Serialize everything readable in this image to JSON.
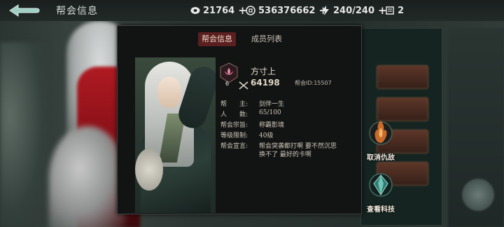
{
  "header": {
    "title": "帮会信息",
    "resources": [
      {
        "icon": "jade-currency-icon",
        "value": "21764",
        "plus": "+"
      },
      {
        "icon": "coin-currency-icon",
        "value": "536376662",
        "plus": "+"
      },
      {
        "icon": "stamina-lightning-icon",
        "value": "240/240",
        "plus": "+"
      },
      {
        "icon": "scroll-token-icon",
        "value": "2"
      }
    ]
  },
  "tabs": [
    {
      "label": "帮会信息",
      "active": true
    },
    {
      "label": "成员列表",
      "active": false
    }
  ],
  "guild": {
    "level": "6",
    "name": "方寸上",
    "power": "64198",
    "id_text": "帮会ID:15507"
  },
  "details": [
    {
      "key": "帮　　主:",
      "value": "剑伴一生"
    },
    {
      "key": "人　　数:",
      "value": "65/100"
    },
    {
      "key": "帮会宗旨:",
      "value": "称霸影境"
    },
    {
      "key": "等级限制:",
      "value": "40级"
    },
    {
      "key": "帮会宣言:",
      "value": "帮会突袭都打啊 要不然沉思"
    },
    {
      "key": "",
      "value": "换不了 最好的卡啊"
    }
  ],
  "side_actions": [
    {
      "label": "取消仇敌",
      "icon": "flame-helmet-icon"
    },
    {
      "label": "查看科技",
      "icon": "crystal-tech-icon"
    }
  ],
  "colors": {
    "accent": "#5a1f1f",
    "panel": "#121414",
    "gold": "#c9a96b"
  }
}
